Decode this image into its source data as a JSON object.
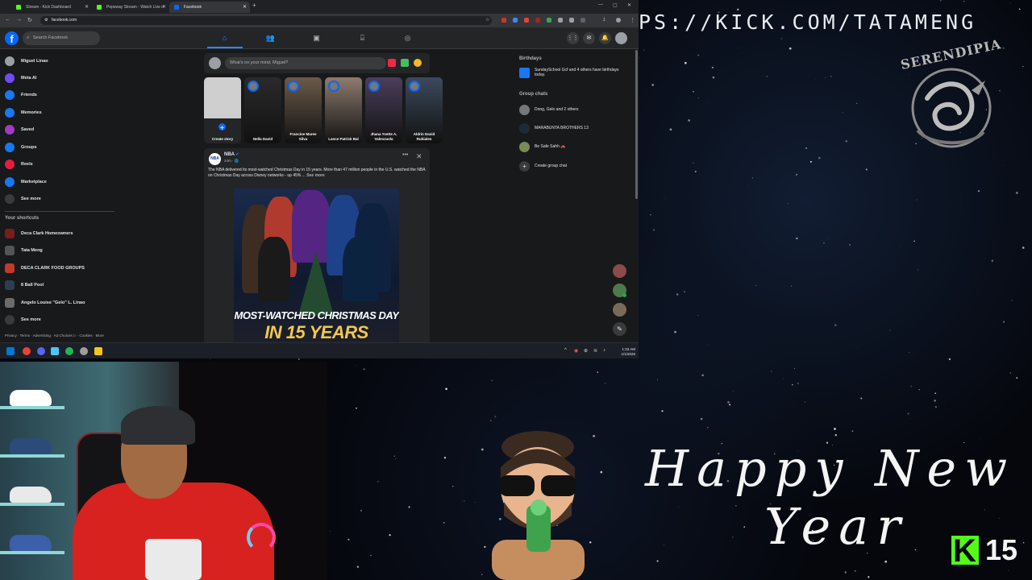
{
  "browser": {
    "tabs": [
      {
        "title": "Stream - Kick Dashboard",
        "active": false,
        "favicon_color": "#53fc18"
      },
      {
        "title": "Pepsway Stream - Watch Live o",
        "active": false,
        "favicon_color": "#53fc18"
      },
      {
        "title": "Facebook",
        "active": true,
        "favicon_color": "#0866ff"
      }
    ],
    "url": "facebook.com"
  },
  "facebook": {
    "search_placeholder": "Search Facebook",
    "logo": "f",
    "nav_icons": [
      "home-icon",
      "friends-icon",
      "video-icon",
      "marketplace-icon",
      "gaming-icon"
    ],
    "left_menu": [
      {
        "label": "Miguel Linao",
        "icon": "profile-avatar",
        "color": "#9aa0a6"
      },
      {
        "label": "Meta AI",
        "icon": "meta-ai-icon",
        "color": "#6f4bff"
      },
      {
        "label": "Friends",
        "icon": "friends-icon",
        "color": "#1877f2"
      },
      {
        "label": "Memories",
        "icon": "memories-icon",
        "color": "#1877f2"
      },
      {
        "label": "Saved",
        "icon": "saved-icon",
        "color": "#a33bc2"
      },
      {
        "label": "Groups",
        "icon": "groups-icon",
        "color": "#1877f2"
      },
      {
        "label": "Reels",
        "icon": "reels-icon",
        "color": "#e41e3f"
      },
      {
        "label": "Marketplace",
        "icon": "marketplace-icon",
        "color": "#1877f2"
      },
      {
        "label": "See more",
        "icon": "chevron-down-icon",
        "color": "#3a3b3c"
      }
    ],
    "shortcuts_heading": "Your shortcuts",
    "shortcuts": [
      {
        "label": "Deca Clark Homeowners",
        "color": "#7a1c1c"
      },
      {
        "label": "Tata Meng",
        "color": "#555"
      },
      {
        "label": "DECA CLARK FOOD GROUPS",
        "color": "#c0392b"
      },
      {
        "label": "8 Ball Pool",
        "color": "#2c3e50"
      },
      {
        "label": "Angelo Louise \"Gelo\" L. Linao",
        "color": "#6b6b6b"
      },
      {
        "label": "See more",
        "color": "#3a3b3c"
      }
    ],
    "footer": "Privacy · Terms · Advertising · Ad Choices ▷ · Cookies · More",
    "composer_placeholder": "What's on your mind, Miguel?",
    "stories": [
      {
        "name": "Create story",
        "color": "#cfcfcf"
      },
      {
        "name": "Nella David",
        "color": "#2a2a2a"
      },
      {
        "name": "Francine Maree Silva",
        "color": "#6b5a4a"
      },
      {
        "name": "Lance Patrick Bal",
        "color": "#8e7b6e"
      },
      {
        "name": "Jhana Yvette A. Valenzuela",
        "color": "#4a3f5c"
      },
      {
        "name": "Aldrin David Rubiales",
        "color": "#3d4a5c"
      }
    ],
    "post": {
      "page_name": "NBA",
      "verified_mark": "✔",
      "time": "24m · 🌐",
      "avatar_text": "NBA",
      "text": "The NBA delivered its most-watched Christmas Day in 15 years.  More than 47 million people in the U.S. watched the NBA on Christmas Day across Disney networks - up 45% ...",
      "see_more": "See more",
      "image_headline_1": "MOST-WATCHED CHRISTMAS DAY",
      "image_headline_2": "IN 15 YEARS"
    },
    "right": {
      "birthdays_heading": "Birthdays",
      "birthday_text": "SundaySchool Gcf and 4 others have birthdays today.",
      "group_chats_heading": "Group chats",
      "group_chats": [
        {
          "name": "Dong, Gelo and 2 others",
          "color": "#777"
        },
        {
          "name": "MARABUNTA BROTHERS 13",
          "color": "#1c2b3a"
        },
        {
          "name": "Be Safe Sahh 🚗",
          "color": "#7a8a5a"
        }
      ],
      "create_group_chat": "Create group chat"
    }
  },
  "taskbar": {
    "time": "1:33 AM",
    "date": "1/1/2026"
  },
  "overlay": {
    "kick_url": "PS://KICK.COM/TATAMENG",
    "logo_text": "SERENDIPIA",
    "greeting_line1": "Happy New",
    "greeting_line2": "Year",
    "kick_badge_letter": "K",
    "viewer_count": "15"
  }
}
